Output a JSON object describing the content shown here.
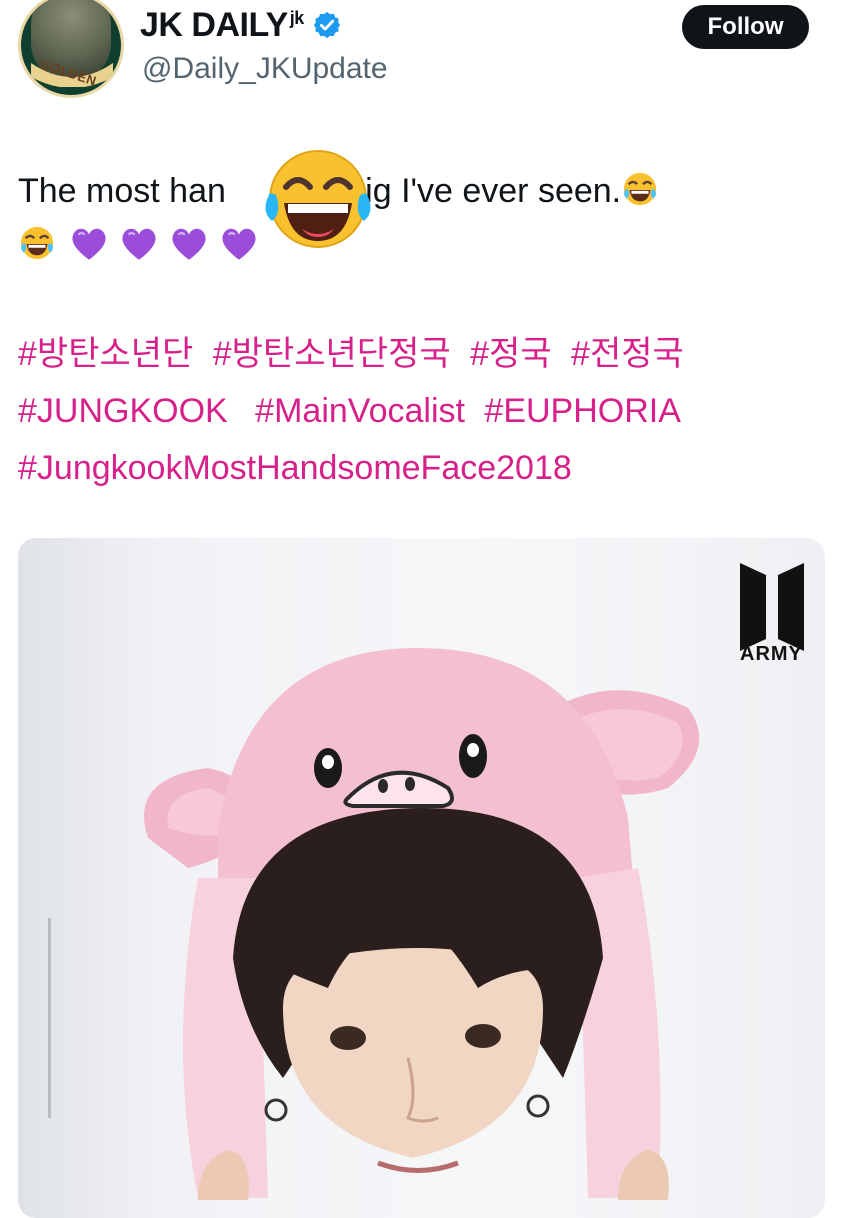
{
  "account": {
    "display_name": "JK DAILY",
    "name_suffix": "jk",
    "handle": "@Daily_JKUpdate",
    "avatar_badge": "GOLDEN",
    "verified_color": "#1d9bf0"
  },
  "follow_button": {
    "label": "Follow"
  },
  "tweet": {
    "text_part1": "The most han",
    "text_part2": "e pig I've ever seen.",
    "emojis": [
      "face-with-tears-of-joy",
      "purple-heart"
    ],
    "hashtags": [
      "#방탄소년단",
      "#방탄소년단정국",
      "#정국",
      "#전정국",
      "#JUNGKOOK",
      "#MainVocalist",
      "#EUPHORIA",
      "#JungkookMostHandsomeFace2018"
    ],
    "hashtag_color": "#d6218a"
  },
  "media": {
    "watermark": "ARMY"
  }
}
